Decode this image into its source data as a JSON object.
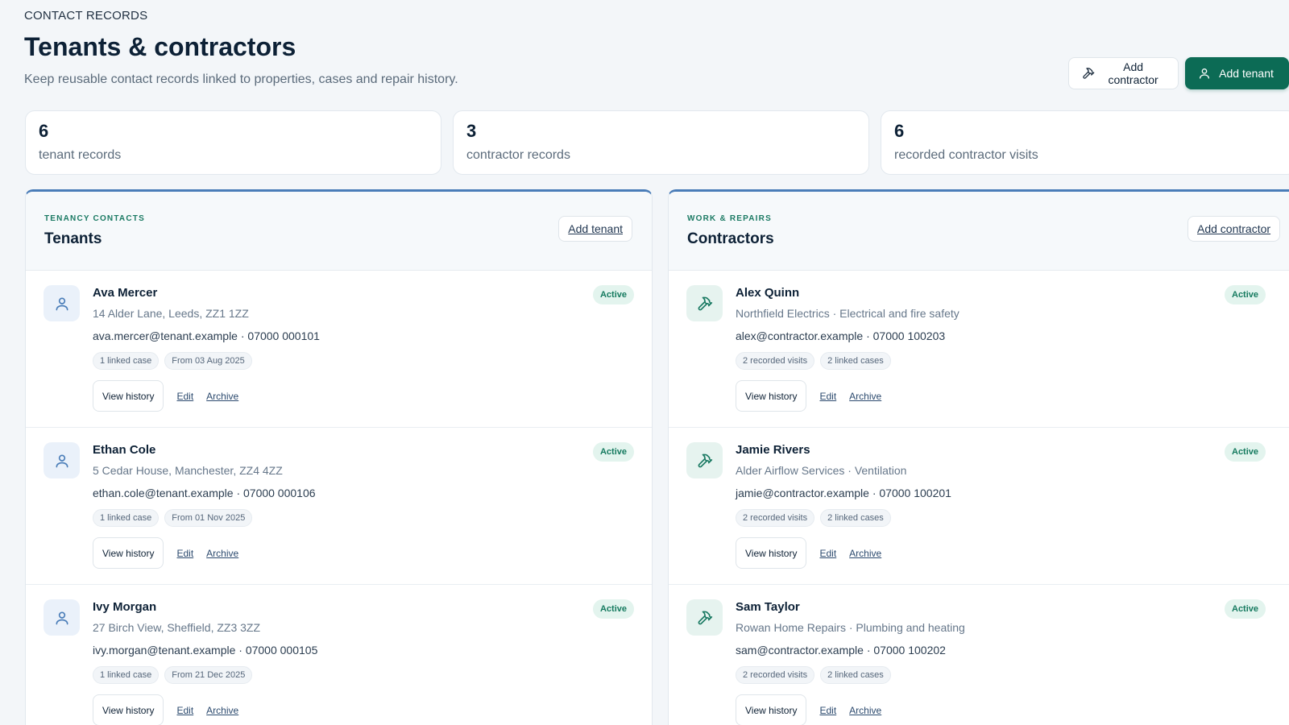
{
  "header": {
    "eyebrow": "CONTACT RECORDS",
    "title": "Tenants & contractors",
    "subtitle": "Keep reusable contact records linked to properties, cases and repair history.",
    "add_contractor_label": "Add contractor",
    "add_tenant_label": "Add tenant"
  },
  "stats": [
    {
      "value": "6",
      "label": "tenant records"
    },
    {
      "value": "3",
      "label": "contractor records"
    },
    {
      "value": "6",
      "label": "recorded contractor visits"
    }
  ],
  "tenants_panel": {
    "kicker": "TENANCY CONTACTS",
    "title": "Tenants",
    "add_label": "Add tenant",
    "records": [
      {
        "name": "Ava Mercer",
        "sub": "14 Alder Lane, Leeds, ZZ1 1ZZ",
        "contact": "ava.mercer@tenant.example · 07000 000101",
        "chips": [
          "1 linked case",
          "From 03 Aug 2025"
        ],
        "status": "Active",
        "view_label": "View history",
        "edit_label": "Edit",
        "archive_label": "Archive"
      },
      {
        "name": "Ethan Cole",
        "sub": "5 Cedar House, Manchester, ZZ4 4ZZ",
        "contact": "ethan.cole@tenant.example · 07000 000106",
        "chips": [
          "1 linked case",
          "From 01 Nov 2025"
        ],
        "status": "Active",
        "view_label": "View history",
        "edit_label": "Edit",
        "archive_label": "Archive"
      },
      {
        "name": "Ivy Morgan",
        "sub": "27 Birch View, Sheffield, ZZ3 3ZZ",
        "contact": "ivy.morgan@tenant.example · 07000 000105",
        "chips": [
          "1 linked case",
          "From 21 Dec 2025"
        ],
        "status": "Active",
        "view_label": "View history",
        "edit_label": "Edit",
        "archive_label": "Archive"
      }
    ]
  },
  "contractors_panel": {
    "kicker": "WORK & REPAIRS",
    "title": "Contractors",
    "add_label": "Add contractor",
    "records": [
      {
        "name": "Alex Quinn",
        "sub": "Northfield Electrics · Electrical and fire safety",
        "contact": "alex@contractor.example · 07000 100203",
        "chips": [
          "2 recorded visits",
          "2 linked cases"
        ],
        "status": "Active",
        "view_label": "View history",
        "edit_label": "Edit",
        "archive_label": "Archive"
      },
      {
        "name": "Jamie Rivers",
        "sub": "Alder Airflow Services · Ventilation",
        "contact": "jamie@contractor.example · 07000 100201",
        "chips": [
          "2 recorded visits",
          "2 linked cases"
        ],
        "status": "Active",
        "view_label": "View history",
        "edit_label": "Edit",
        "archive_label": "Archive"
      },
      {
        "name": "Sam Taylor",
        "sub": "Rowan Home Repairs · Plumbing and heating",
        "contact": "sam@contractor.example · 07000 100202",
        "chips": [
          "2 recorded visits",
          "2 linked cases"
        ],
        "status": "Active",
        "view_label": "View history",
        "edit_label": "Edit",
        "archive_label": "Archive"
      }
    ]
  },
  "icons": {
    "tenant": "user-icon",
    "contractor": "hammer-icon"
  },
  "colors": {
    "primary": "#0c6b55",
    "panel_accent": "#4a7db8",
    "active_badge_bg": "#e3f4ee",
    "active_badge_text": "#157a5f"
  }
}
